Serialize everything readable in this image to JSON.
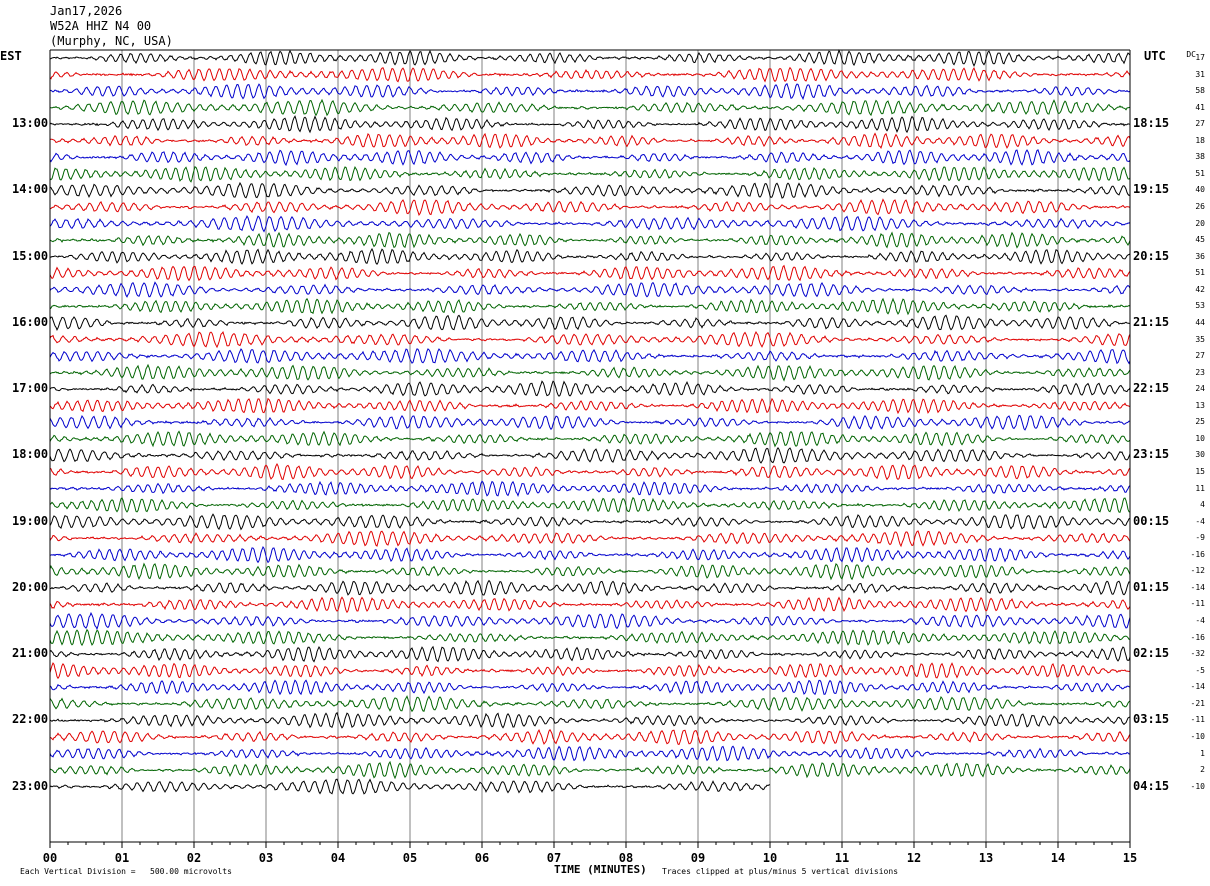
{
  "header": {
    "date": "Jan17,2026",
    "station": "W52A HHZ N4 00",
    "location": "(Murphy, NC, USA)"
  },
  "left_tz_label": "EST",
  "right_tz_label": "UTC",
  "dc_header": "DC",
  "footer": {
    "vertical_division": "Each Vertical Division =   500.00 microvolts",
    "clip_note": "Traces clipped at plus/minus 5 vertical divisions"
  },
  "colors": {
    "trace_cycle": [
      "#000000",
      "#e00000",
      "#0000cc",
      "#006400"
    ],
    "grid": "#808080",
    "background": "#ffffff"
  },
  "chart_data": {
    "type": "seismogram",
    "title": "W52A HHZ N4 00",
    "xlabel": "TIME (MINUTES)",
    "x_ticks": [
      "00",
      "01",
      "02",
      "03",
      "04",
      "05",
      "06",
      "07",
      "08",
      "09",
      "10",
      "11",
      "12",
      "13",
      "14",
      "15"
    ],
    "xlim": [
      0,
      15
    ],
    "line_interval_minutes": 15,
    "left_hour_labels": [
      "13:00",
      "14:00",
      "15:00",
      "16:00",
      "17:00",
      "18:00",
      "19:00",
      "20:00",
      "21:00",
      "22:00",
      "23:00"
    ],
    "right_hour_labels": [
      "18:15",
      "19:15",
      "20:15",
      "21:15",
      "22:15",
      "23:15",
      "00:15",
      "01:15",
      "02:15",
      "03:15",
      "04:15"
    ],
    "dc_offsets": [
      17,
      31,
      58,
      41,
      27,
      18,
      38,
      51,
      40,
      26,
      20,
      45,
      36,
      51,
      42,
      53,
      44,
      35,
      27,
      23,
      24,
      13,
      25,
      10,
      30,
      15,
      11,
      4,
      -4,
      -9,
      -16,
      -12,
      -14,
      -11,
      -4,
      -16,
      -32,
      -5,
      -14,
      -21,
      -11,
      -10,
      1,
      2,
      -10
    ],
    "trace_count": 45,
    "last_trace_minutes": 10,
    "clip_divisions": 5
  }
}
